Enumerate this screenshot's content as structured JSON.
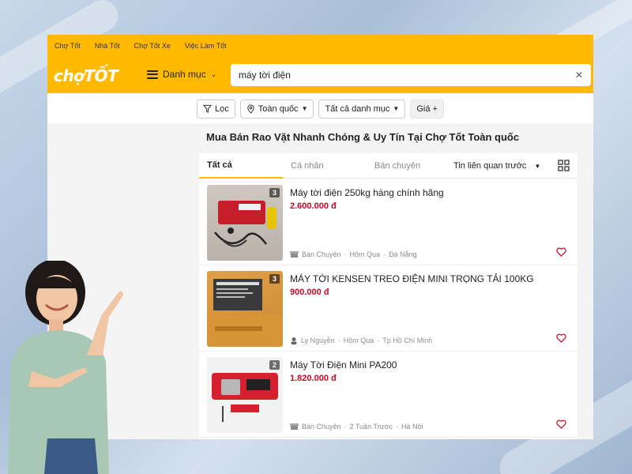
{
  "topbar": {
    "links": [
      "Chợ Tốt",
      "Nhà Tốt",
      "Chợ Tốt Xe",
      "Việc Làm Tốt"
    ]
  },
  "header": {
    "logo": "chợTỐT",
    "category_label": "Danh mục",
    "search_value": "máy tời điện"
  },
  "filters": {
    "filter_label": "Lọc",
    "location_label": "Toàn quốc",
    "category_label": "Tất cả danh mục",
    "price_label": "Giá +"
  },
  "page_title": "Mua Bán Rao Vặt Nhanh Chóng & Uy Tín Tại Chợ Tốt Toàn quốc",
  "tabs": [
    "Tất cả",
    "Cá nhân",
    "Bán chuyên"
  ],
  "sort_label": "Tin liên quan trước",
  "colors": {
    "brand": "#ffba00",
    "price": "#c90927"
  },
  "listings": [
    {
      "title": "Máy tời điện 250kg hàng chính hãng",
      "price": "2.600.000 đ",
      "image_count": "3",
      "seller": "Bán Chuyên",
      "time": "Hôm Qua",
      "location": "Đà Nẵng"
    },
    {
      "title": "MÁY TỜI KENSEN TREO ĐIỆN MINI TRỌNG TẢI 100KG",
      "price": "900.000 đ",
      "image_count": "3",
      "seller": "Ly Nguyễn",
      "time": "Hôm Qua",
      "location": "Tp Hồ Chí Minh"
    },
    {
      "title": "Máy Tời Điện Mini PA200",
      "price": "1.820.000 đ",
      "image_count": "2",
      "seller": "Bán Chuyên",
      "time": "2 Tuần Trước",
      "location": "Hà Nội"
    }
  ]
}
